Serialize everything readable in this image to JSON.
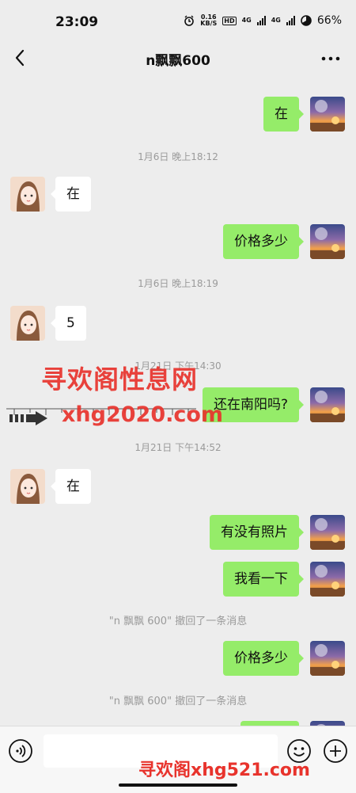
{
  "status": {
    "time": "23:09",
    "net_speed_value": "0.16",
    "net_speed_unit": "KB/S",
    "hd_label": "HD",
    "sig1_label": "4G",
    "sig2_label": "4G",
    "battery": "66%"
  },
  "header": {
    "title": "n飘飘600"
  },
  "messages": {
    "m1": "在",
    "t1": "1月6日 晚上18:12",
    "m2": "在",
    "m3": "价格多少",
    "t2": "1月6日 晚上18:19",
    "m4": "5",
    "t3": "1月21日 下午14:30",
    "m5": "还在南阳吗?",
    "t4": "1月21日 下午14:52",
    "m6": "在",
    "m7": "有没有照片",
    "m8": "我看一下",
    "s1": "\"n 飘飘 600\" 撤回了一条消息",
    "m9": "价格多少",
    "s2": "\"n 飘飘 600\" 撤回了一条消息"
  },
  "watermarks": {
    "main": "寻欢阁性息网",
    "url": "xhg2020.com",
    "bottom": "寻欢阁xhg521.com"
  },
  "colors": {
    "self_bubble": "#95ec69",
    "other_bubble": "#ffffff",
    "watermark": "#e8332c"
  },
  "icons": {
    "back": "chevron-left-icon",
    "more": "more-dots-icon",
    "voice": "voice-icon",
    "emoji": "emoji-icon",
    "add": "add-icon"
  }
}
